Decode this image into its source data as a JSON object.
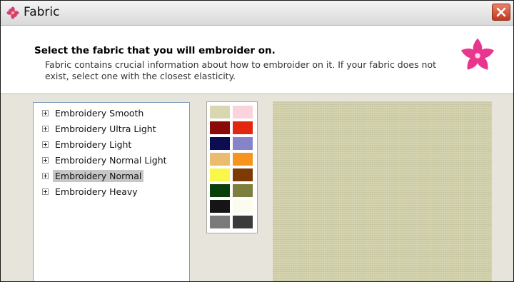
{
  "window": {
    "title": "Fabric"
  },
  "header": {
    "title": "Select the fabric that you will embroider on.",
    "description": "Fabric contains crucial information about how to embroider on it. If your fabric does not exist, select one with the closest elasticity."
  },
  "fabric_tree": {
    "items": [
      {
        "label": "Embroidery Smooth",
        "selected": false
      },
      {
        "label": "Embroidery Ultra Light",
        "selected": false
      },
      {
        "label": "Embroidery Light",
        "selected": false
      },
      {
        "label": "Embroidery Normal Light",
        "selected": false
      },
      {
        "label": "Embroidery Normal",
        "selected": true
      },
      {
        "label": "Embroidery Heavy",
        "selected": false
      }
    ]
  },
  "colors": {
    "swatches": [
      "#d9d6b2",
      "#fbd3dc",
      "#8a0a0a",
      "#e3260f",
      "#0c0c50",
      "#8783c8",
      "#ebbc6f",
      "#f7941d",
      "#f9f74a",
      "#7e3a05",
      "#0a3f0a",
      "#7e7e3e",
      "#151515",
      "#fbfbf0",
      "#7b7b7b",
      "#3b3b3b"
    ],
    "preview_fabric": "#d2d1ab",
    "selection_highlight": "#c6c6c6",
    "close_button": "#c9432a",
    "logo_flower": "#e8368f"
  },
  "icons": {
    "title": "flower-icon",
    "close": "close-icon",
    "logo": "flower-logo-icon"
  }
}
